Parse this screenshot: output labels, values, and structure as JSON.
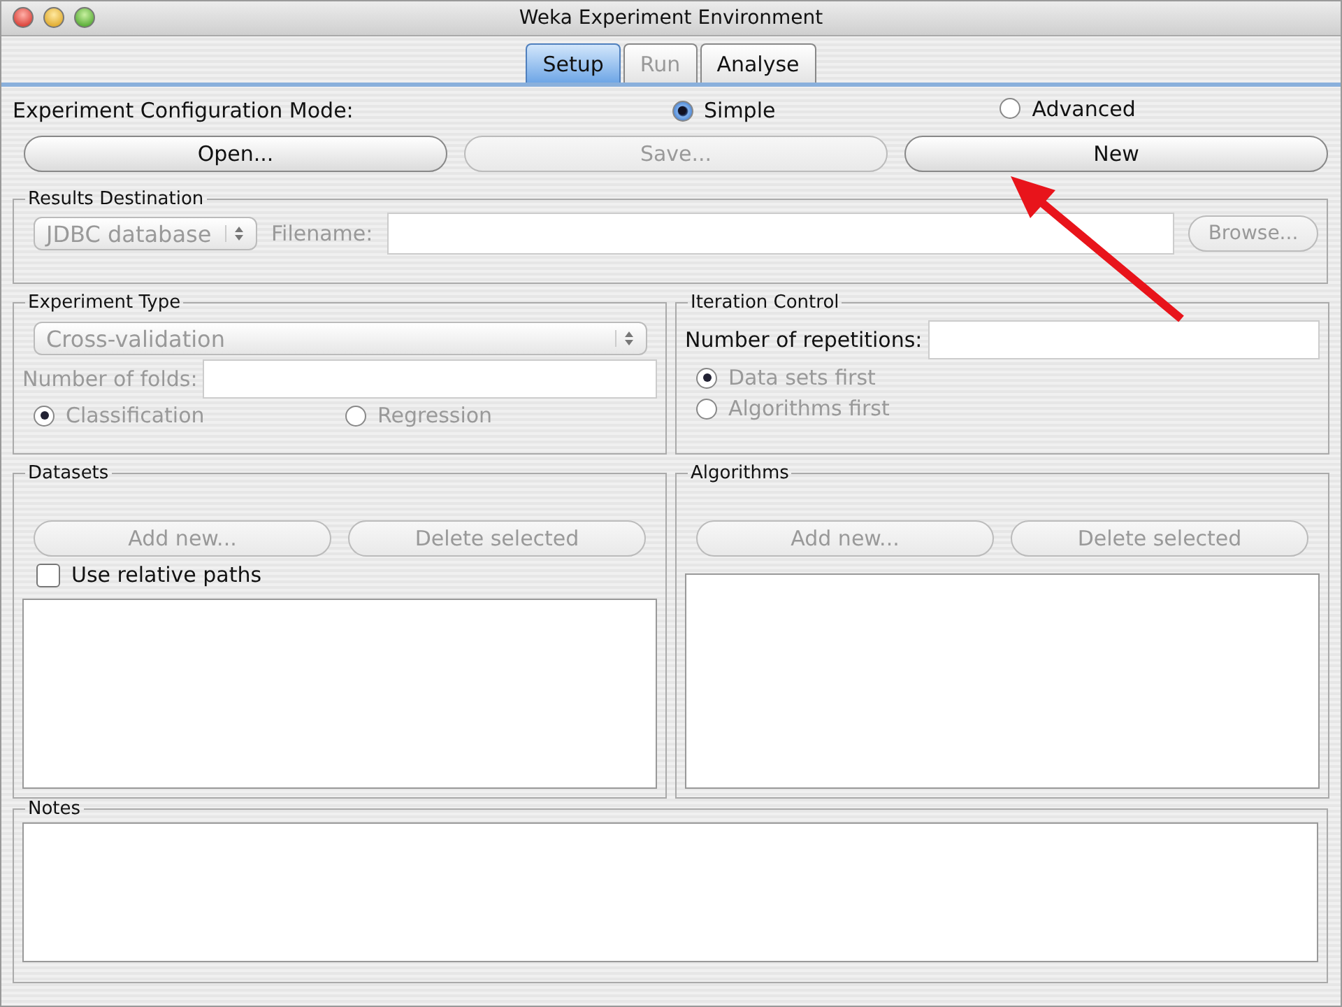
{
  "window": {
    "title": "Weka Experiment Environment"
  },
  "tabs": [
    {
      "label": "Setup",
      "selected": true,
      "disabled": false
    },
    {
      "label": "Run",
      "selected": false,
      "disabled": true
    },
    {
      "label": "Analyse",
      "selected": false,
      "disabled": false
    }
  ],
  "mode": {
    "label": "Experiment Configuration Mode:",
    "options": [
      {
        "label": "Simple",
        "selected": true
      },
      {
        "label": "Advanced",
        "selected": false
      }
    ]
  },
  "buttons": [
    {
      "label": "Open...",
      "disabled": false
    },
    {
      "label": "Save...",
      "disabled": true
    },
    {
      "label": "New",
      "disabled": false
    }
  ],
  "results_destination": {
    "title": "Results Destination",
    "destination": {
      "value": "JDBC database",
      "disabled": true
    },
    "filename_label": "Filename:",
    "browse": {
      "label": "Browse...",
      "disabled": true
    }
  },
  "experiment_type": {
    "title": "Experiment Type",
    "type": {
      "value": "Cross-validation",
      "disabled": true
    },
    "folds_label": "Number of folds:",
    "options": [
      {
        "label": "Classification",
        "selected": true,
        "disabled": true
      },
      {
        "label": "Regression",
        "selected": false,
        "disabled": true
      }
    ]
  },
  "iteration_control": {
    "title": "Iteration Control",
    "repetitions_label": "Number of repetitions:",
    "options": [
      {
        "label": "Data sets first",
        "selected": true,
        "disabled": true
      },
      {
        "label": "Algorithms first",
        "selected": false,
        "disabled": true
      }
    ]
  },
  "datasets": {
    "title": "Datasets",
    "buttons": [
      {
        "label": "Add new...",
        "disabled": true
      },
      {
        "label": "Delete selected",
        "disabled": true
      }
    ],
    "relative_paths": {
      "label": "Use relative paths",
      "checked": false
    }
  },
  "algorithms": {
    "title": "Algorithms",
    "buttons": [
      {
        "label": "Add new...",
        "disabled": true
      },
      {
        "label": "Delete selected",
        "disabled": true
      }
    ]
  },
  "notes": {
    "title": "Notes"
  }
}
